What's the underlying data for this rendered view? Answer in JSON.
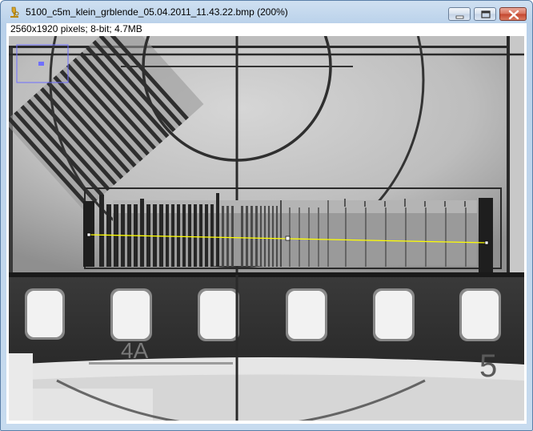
{
  "window": {
    "title": "5100_c5m_klein_grblende_05.04.2011_11.43.22.bmp (200%)",
    "icon": "microscope-icon",
    "controls": [
      "minimize-icon",
      "maximize-icon",
      "close-icon"
    ]
  },
  "image_info": "2560x1920 pixels; 8-bit; 4.7MB",
  "canvas": {
    "scale_markings": [
      "4A",
      "5"
    ],
    "navigator_box_color": "#6f6fff",
    "line_selection_color": "#ffff00"
  }
}
